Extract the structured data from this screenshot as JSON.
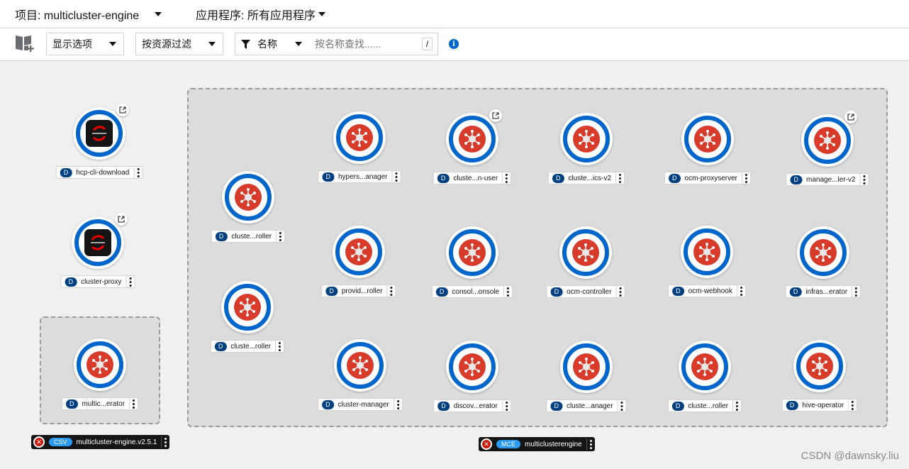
{
  "header": {
    "project_label": "项目: multicluster-engine",
    "app_label": "应用程序: 所有应用程序"
  },
  "toolbar": {
    "display_options": "显示选项",
    "filter_by_resource": "按资源过滤",
    "filter_type": "名称",
    "search_placeholder": "按名称查找......",
    "shortcut_key": "/"
  },
  "nodes": {
    "n1": "hcp-cli-download",
    "n2": "cluster-proxy",
    "n3": "multic...erator",
    "n4": "cluste...roller",
    "n5": "cluste...roller",
    "n6": "hypers...anager",
    "n7": "cluste...n-user",
    "n8": "cluste...ics-v2",
    "n9": "ocm-proxyserver",
    "n10": "manage...ler-v2",
    "n11": "provid...roller",
    "n12": "consol...onsole",
    "n13": "ocm-controller",
    "n14": "ocm-webhook",
    "n15": "infras...erator",
    "n16": "cluster-manager",
    "n17": "discov...erator",
    "n18": "cluste...anager",
    "n19": "cluste...roller",
    "n20": "hive-operator"
  },
  "kind_badge": "D",
  "groups": {
    "csv": {
      "badge": "CSV",
      "name": "multicluster-engine.v2.5.1"
    },
    "mce": {
      "badge": "MCE",
      "name": "multiclusterengine"
    }
  },
  "error_symbol": "✕",
  "watermark": "CSDN @dawnsky.liu",
  "colors": {
    "ring_blue": "#0066cc",
    "pod_red": "#d93b2b",
    "badge_navy": "#004080",
    "badge_blue": "#2b9af3"
  }
}
